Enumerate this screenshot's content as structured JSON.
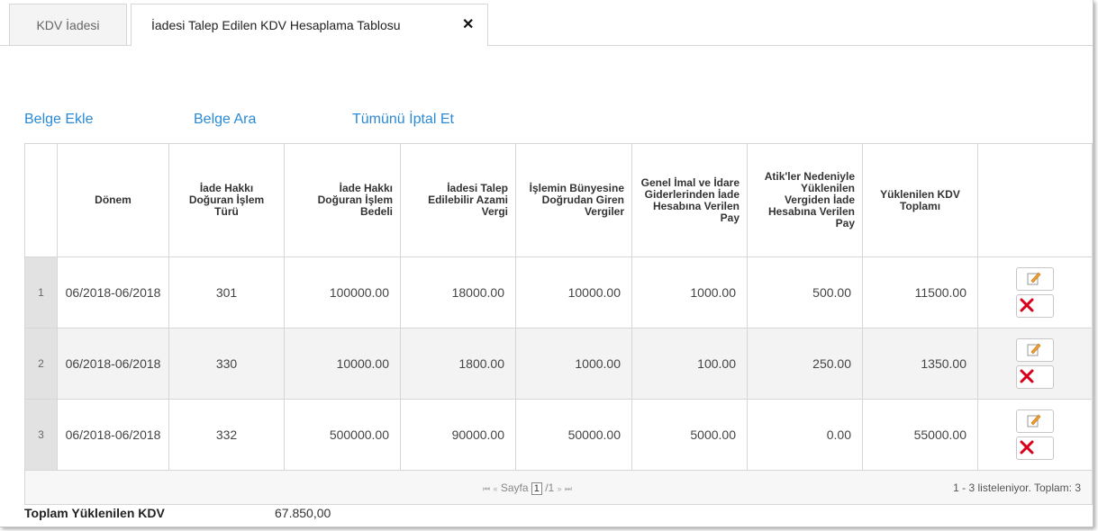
{
  "tabs": [
    {
      "label": "KDV İadesi",
      "active": false
    },
    {
      "label": "İadesi Talep Edilen KDV Hesaplama Tablosu",
      "active": true
    }
  ],
  "tab_close_icon": "✕",
  "actions": {
    "add": "Belge Ekle",
    "search": "Belge Ara",
    "cancel_all": "Tümünü İptal Et"
  },
  "table": {
    "headers": [
      "",
      "Dönem",
      "İade Hakkı Doğuran İşlem Türü",
      "İade Hakkı Doğuran İşlem Bedeli",
      "İadesi Talep Edilebilir Azami Vergi",
      "İşlemin Bünyesine Doğrudan Giren Vergiler",
      "Genel İmal ve İdare Giderlerinden İade Hesabına Verilen Pay",
      "Atik'ler Nedeniyle Yüklenilen Vergiden İade Hesabına Verilen Pay",
      "Yüklenilen KDV Toplamı",
      ""
    ],
    "rows": [
      {
        "num": "1",
        "donem": "06/2018-06/2018",
        "islem_turu": "301",
        "islem_bedeli": "100000.00",
        "azami_vergi": "18000.00",
        "dogrudan": "10000.00",
        "genel_imal": "1000.00",
        "atik": "500.00",
        "toplam": "11500.00"
      },
      {
        "num": "2",
        "donem": "06/2018-06/2018",
        "islem_turu": "330",
        "islem_bedeli": "10000.00",
        "azami_vergi": "1800.00",
        "dogrudan": "1000.00",
        "genel_imal": "100.00",
        "atik": "250.00",
        "toplam": "1350.00"
      },
      {
        "num": "3",
        "donem": "06/2018-06/2018",
        "islem_turu": "332",
        "islem_bedeli": "500000.00",
        "azami_vergi": "90000.00",
        "dogrudan": "50000.00",
        "genel_imal": "5000.00",
        "atik": "0.00",
        "toplam": "55000.00"
      }
    ],
    "pager": {
      "first": "⏮",
      "prev": "«",
      "label": "Sayfa",
      "current": "1",
      "total": "/1",
      "next": "»",
      "last": "⏭"
    },
    "count_text": "1 - 3 listeleniyor. Toplam: 3"
  },
  "total": {
    "label": "Toplam Yüklenilen KDV",
    "value": "67.850,00"
  },
  "colors": {
    "link": "#2b8ad6",
    "delete_icon": "#d9001b",
    "edit_icon": "#e08a1e"
  }
}
